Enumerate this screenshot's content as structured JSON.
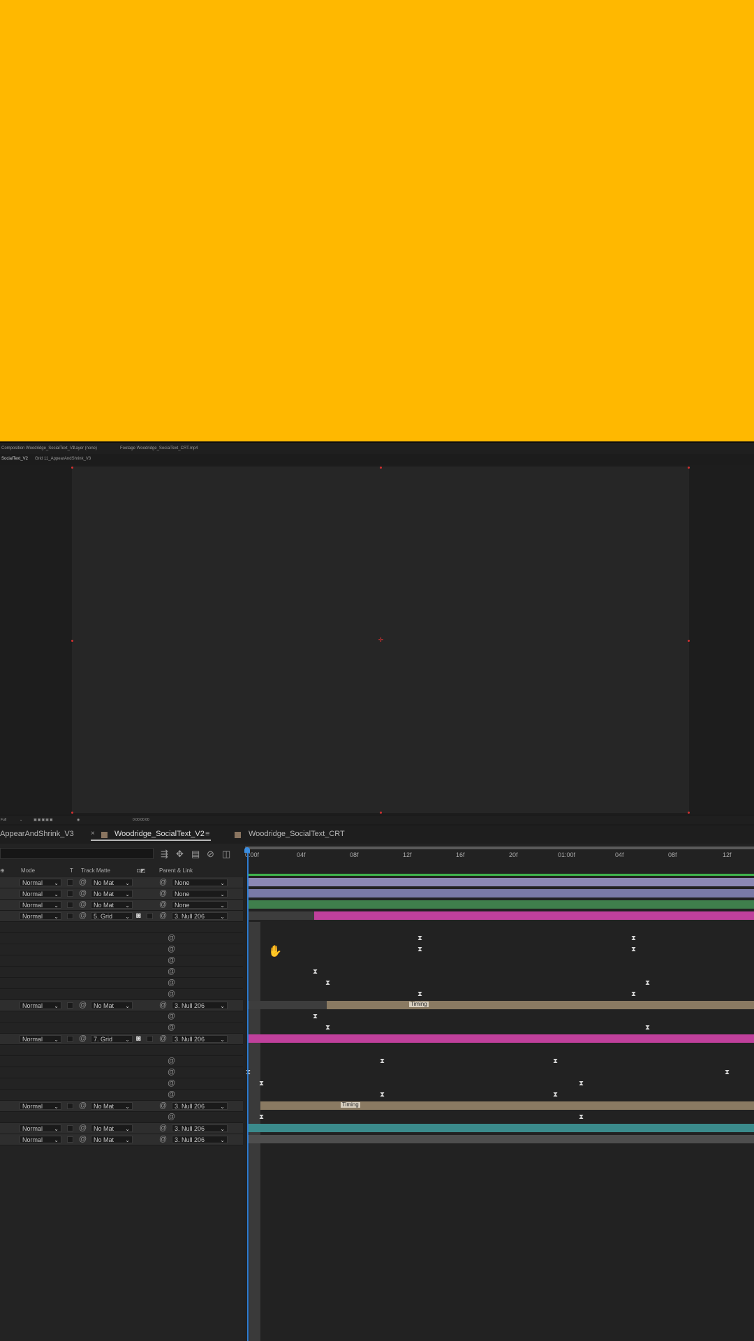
{
  "preview": {
    "color": "#FFB800"
  },
  "viewer": {
    "panel_tabs": [
      "Composition Woodridge_SocialText_V2",
      "Layer (none)",
      "Footage Woodridge_SocialText_CRT.mp4"
    ],
    "comp_tabs": [
      "SocialText_V2",
      "Grid 11_AppearAndShrink_V3"
    ],
    "bottom_bar": {
      "resolution": "Full",
      "timecode": "0:00:00:00"
    }
  },
  "timeline": {
    "tabs": [
      "AppearAndShrink_V3",
      "Woodridge_SocialText_V2",
      "Woodridge_SocialText_CRT"
    ],
    "columns": {
      "mode": "Mode",
      "t": "T",
      "track_matte": "Track Matte",
      "parent": "Parent & Link"
    },
    "ruler": [
      "0:00f",
      "04f",
      "08f",
      "12f",
      "16f",
      "20f",
      "01:00f",
      "04f",
      "08f",
      "12f"
    ],
    "layers": [
      {
        "mode": "Normal",
        "matte": "No Mat",
        "parent": "None"
      },
      {
        "mode": "Normal",
        "matte": "No Mat",
        "parent": "None"
      },
      {
        "mode": "Normal",
        "matte": "No Mat",
        "parent": "None"
      },
      {
        "mode": "Normal",
        "matte": "5. Grid",
        "parent": "3. Null 206"
      },
      {
        "mode": "Normal",
        "matte": "No Mat",
        "parent": "3. Null 206"
      },
      {
        "mode": "Normal",
        "matte": "7. Grid",
        "parent": "3. Null 206"
      },
      {
        "mode": "Normal",
        "matte": "No Mat",
        "parent": "3. Null 206"
      },
      {
        "mode": "Normal",
        "matte": "No Mat",
        "parent": "3. Null 206"
      },
      {
        "mode": "Normal",
        "matte": "No Mat",
        "parent": "3. Null 206"
      }
    ],
    "marker_label": "Timing",
    "colors": {
      "green": "#3f8f4c",
      "lavender": "#8c88b4",
      "magenta": "#c0409c",
      "tan": "#8a7a62",
      "teal": "#3b8b8c",
      "gray": "#4e4e4e",
      "cti": "#2f7dd1"
    }
  }
}
